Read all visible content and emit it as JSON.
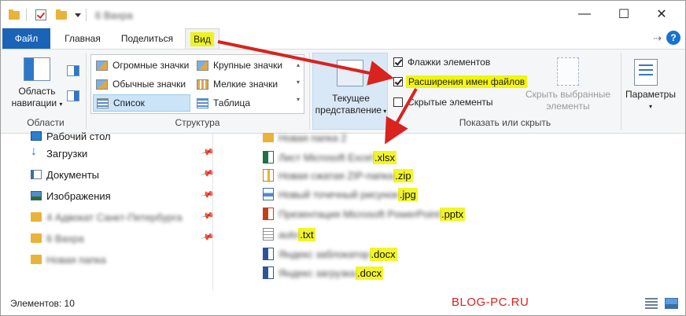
{
  "titlebar": {
    "title_blurred": "6 Вахра",
    "minimize": "—",
    "maximize": "☐",
    "close": "✕"
  },
  "tabs": {
    "file": "Файл",
    "home": "Главная",
    "share": "Поделиться",
    "view": "Вид"
  },
  "ribbon": {
    "panes": {
      "nav_pane_label_1": "Область",
      "nav_pane_label_2": "навигации",
      "group_label": "Области"
    },
    "layout": {
      "items": [
        "Огромные значки",
        "Крупные значки",
        "Обычные значки",
        "Мелкие значки",
        "Список",
        "Таблица"
      ],
      "group_label": "Структура"
    },
    "current_view": {
      "label_1": "Текущее",
      "label_2": "представление"
    },
    "show_hide": {
      "item_checkboxes": "Флажки элементов",
      "file_extensions": "Расширения имен файлов",
      "hidden_items": "Скрытые элементы",
      "hide_selected_1": "Скрыть выбранные",
      "hide_selected_2": "элементы",
      "group_label": "Показать или скрыть"
    },
    "options": {
      "label": "Параметры"
    }
  },
  "navpane": {
    "items": [
      "Рабочий стол",
      "Загрузки",
      "Документы",
      "Изображения",
      "4 Адвокат Санкт-Петербурга",
      "6 Вахра",
      "Новая папка"
    ]
  },
  "files": [
    {
      "name": "Новая папка 2",
      "ext": ""
    },
    {
      "name": "Лист Microsoft Excel",
      "ext": ".xlsx"
    },
    {
      "name": "Новая сжатая ZIP-папка",
      "ext": ".zip"
    },
    {
      "name": "Новый точечный рисунок",
      "ext": ".jpg"
    },
    {
      "name": "Презентация Microsoft PowerPoint",
      "ext": ".pptx"
    },
    {
      "name": "auto",
      "ext": ".txt"
    },
    {
      "name": "Яндекс заблокатор",
      "ext": ".docx"
    },
    {
      "name": "Яндекс загрузка",
      "ext": ".docx"
    }
  ],
  "statusbar": {
    "count": "Элементов: 10",
    "watermark": "BLOG-PC.RU"
  },
  "colors": {
    "accent": "#1a63b7",
    "highlight": "#f2f52a",
    "arrow": "#d8231f"
  }
}
